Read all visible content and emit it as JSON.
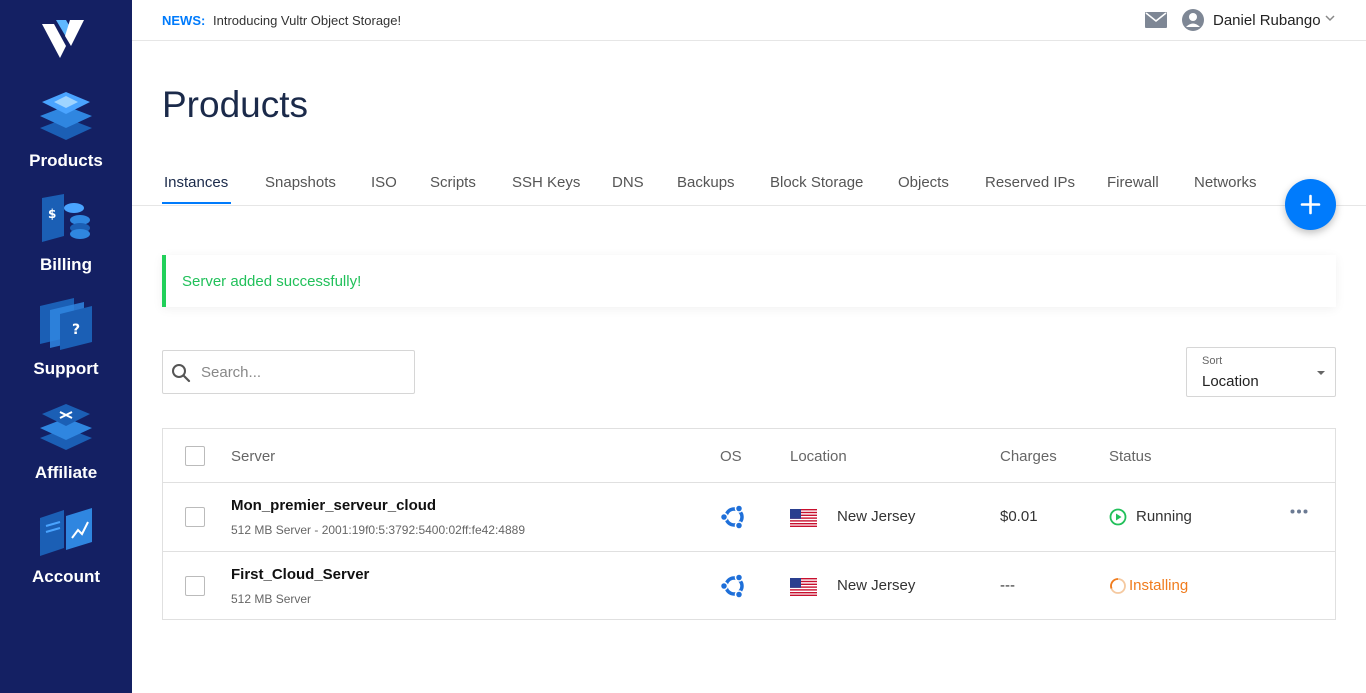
{
  "sidebar": {
    "items": [
      {
        "label": "Products"
      },
      {
        "label": "Billing"
      },
      {
        "label": "Support"
      },
      {
        "label": "Affiliate"
      },
      {
        "label": "Account"
      }
    ]
  },
  "topbar": {
    "news_tag": "NEWS:",
    "news_text": "Introducing Vultr Object Storage!",
    "user_name": "Daniel Rubango"
  },
  "page": {
    "title": "Products"
  },
  "tabs": [
    {
      "label": "Instances",
      "active": true
    },
    {
      "label": "Snapshots"
    },
    {
      "label": "ISO"
    },
    {
      "label": "Scripts"
    },
    {
      "label": "SSH Keys"
    },
    {
      "label": "DNS"
    },
    {
      "label": "Backups"
    },
    {
      "label": "Block Storage"
    },
    {
      "label": "Objects"
    },
    {
      "label": "Reserved IPs"
    },
    {
      "label": "Firewall"
    },
    {
      "label": "Networks"
    }
  ],
  "alert": {
    "text": "Server added successfully!"
  },
  "search": {
    "placeholder": "Search...",
    "value": ""
  },
  "sort": {
    "label": "Sort",
    "value": "Location"
  },
  "table": {
    "headers": {
      "server": "Server",
      "os": "OS",
      "location": "Location",
      "charges": "Charges",
      "status": "Status"
    },
    "rows": [
      {
        "name": "Mon_premier_serveur_cloud",
        "sub": "512 MB Server - 2001:19f0:5:3792:5400:02ff:fe42:4889",
        "os": "ubuntu-icon",
        "location": "New Jersey",
        "charges": "$0.01",
        "status": "Running"
      },
      {
        "name": "First_Cloud_Server",
        "sub": "512 MB Server",
        "os": "ubuntu-icon",
        "location": "New Jersey",
        "charges": "---",
        "status": "Installing"
      }
    ]
  },
  "colors": {
    "sidebar_bg": "#142063",
    "accent": "#007bfc",
    "success": "#21c05a",
    "installing": "#f07c1e"
  }
}
